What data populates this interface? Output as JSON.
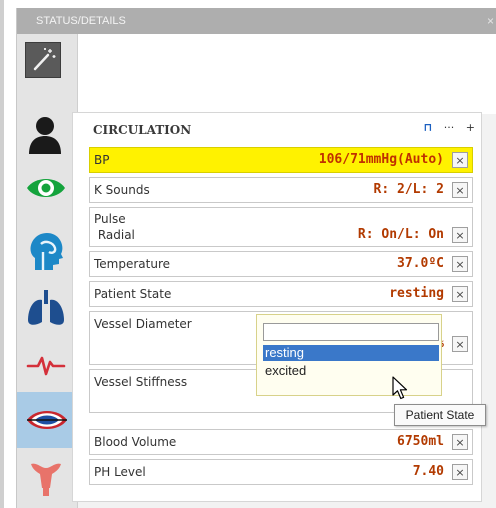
{
  "window": {
    "title": "STATUS/DETAILS",
    "close": "×"
  },
  "sidebar": {
    "icons": [
      {
        "name": "magic-wand-icon"
      },
      {
        "name": "person-icon"
      },
      {
        "name": "eye-icon"
      },
      {
        "name": "head-airway-icon"
      },
      {
        "name": "lungs-icon"
      },
      {
        "name": "heartbeat-icon"
      },
      {
        "name": "vessels-icon",
        "selected": true
      },
      {
        "name": "uterus-icon"
      }
    ]
  },
  "panel": {
    "title": "CIRCULATION",
    "controls": {
      "pin": "⊓",
      "more": "···",
      "add": "+"
    },
    "rows": [
      {
        "label": "BP",
        "value": "106/71mmHg(Auto)",
        "highlight": true
      },
      {
        "label": "K Sounds",
        "value": "R: 2/L: 2"
      },
      {
        "label": "Pulse",
        "label2": " Radial",
        "value": "R: On/L: On"
      },
      {
        "label": "Temperature",
        "value": "37.0ºC"
      },
      {
        "label": "Patient State",
        "value": "resting"
      },
      {
        "label": "Vessel Diameter",
        "value": "%"
      },
      {
        "label": "Vessel Stiffness",
        "value": ""
      },
      {
        "label": "Blood Volume",
        "value": "6750ml"
      },
      {
        "label": "PH Level",
        "value": "7.40"
      }
    ],
    "remove_label": "×"
  },
  "dropdown": {
    "input_value": "",
    "options": [
      {
        "label": "resting",
        "selected": true
      },
      {
        "label": "excited",
        "selected": false
      }
    ]
  },
  "tooltip": "Patient State",
  "colors": {
    "highlight": "#fff200",
    "value_text": "#b23a00",
    "selected_option": "#3a78c9",
    "selected_icon_bg": "#a9cbe6"
  }
}
